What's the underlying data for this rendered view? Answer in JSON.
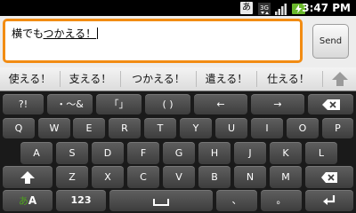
{
  "status_bar": {
    "ime_indicator": "あ",
    "network_type": "3G",
    "time": "3:47 PM"
  },
  "compose": {
    "text_plain": "横でも",
    "text_composing": "つかえる！",
    "send_label": "Send"
  },
  "candidates": [
    "使える！",
    "支える！",
    "つかえる！",
    "遣える！",
    "仕える！"
  ],
  "keyboard": {
    "row0": [
      "?!",
      "・〜&",
      "「」",
      "( )",
      "←",
      "→"
    ],
    "row1": [
      "Q",
      "W",
      "E",
      "R",
      "T",
      "Y",
      "U",
      "I",
      "O",
      "P"
    ],
    "row2": [
      "A",
      "S",
      "D",
      "F",
      "G",
      "H",
      "J",
      "K",
      "L"
    ],
    "row3": [
      "Z",
      "X",
      "C",
      "V",
      "B",
      "N",
      "M"
    ],
    "mode_kana": "あ",
    "mode_alpha": "A",
    "numeric": "123",
    "punct_comma": "、",
    "punct_period": "。"
  },
  "colors": {
    "focus_border": "#f28c13",
    "ime_green": "#4ea01f",
    "battery_green": "#6ab82c"
  }
}
